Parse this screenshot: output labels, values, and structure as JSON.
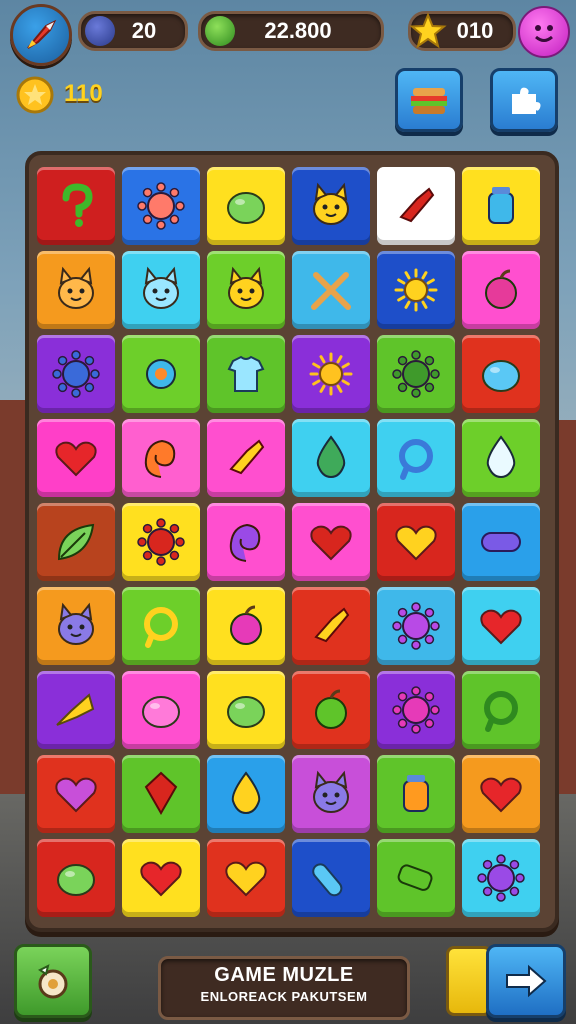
{
  "hud": {
    "hearts_value": "20",
    "coins_value": "22.800",
    "stars_value": "010",
    "gold_value": "110"
  },
  "board": {
    "rows": [
      [
        {
          "color": "#cf1f1f",
          "icon": "question-mark-icon"
        },
        {
          "color": "#2a73e6",
          "icon": "starfish-icon"
        },
        {
          "color": "#ffe01f",
          "icon": "green-leaf-blob-icon"
        },
        {
          "color": "#1e4fc9",
          "icon": "yellow-cat-icon"
        },
        {
          "color": "#ffffff",
          "icon": "red-hand-icon"
        },
        {
          "color": "#ffe01f",
          "icon": "blue-jar-icon"
        }
      ],
      [
        {
          "color": "#f59a1e",
          "icon": "orange-cat-icon"
        },
        {
          "color": "#3fd0f0",
          "icon": "blue-cat-icon"
        },
        {
          "color": "#6dcf2a",
          "icon": "yellow-cat-icon"
        },
        {
          "color": "#3fb8ea",
          "icon": "crossed-swords-icon"
        },
        {
          "color": "#1e4fc9",
          "icon": "yellow-sun-creature-icon"
        },
        {
          "color": "#ff4fcf",
          "icon": "pink-apple-icon"
        }
      ],
      [
        {
          "color": "#8a2fd9",
          "icon": "blue-spiky-ball-icon"
        },
        {
          "color": "#6dcf2a",
          "icon": "blue-gear-icon"
        },
        {
          "color": "#5fc42a",
          "icon": "shirt-icon"
        },
        {
          "color": "#8a2fd9",
          "icon": "sun-icon"
        },
        {
          "color": "#5fc42a",
          "icon": "green-bush-icon"
        },
        {
          "color": "#e0321e",
          "icon": "blue-fish-icon"
        }
      ],
      [
        {
          "color": "#ff3fc8",
          "icon": "red-heart-icon"
        },
        {
          "color": "#ff5fcf",
          "icon": "orange-swirl-icon"
        },
        {
          "color": "#ff4fcf",
          "icon": "yellow-hand-icon"
        },
        {
          "color": "#3fd0f0",
          "icon": "green-drop-icon"
        },
        {
          "color": "#3fd0f0",
          "icon": "blue-shell-icon"
        },
        {
          "color": "#6dcf2a",
          "icon": "white-drop-icon"
        }
      ],
      [
        {
          "color": "#b8431e",
          "icon": "green-leaf-icon"
        },
        {
          "color": "#ffe01f",
          "icon": "red-flower-icon"
        },
        {
          "color": "#ff4fcf",
          "icon": "purple-swirl-icon"
        },
        {
          "color": "#ff4fcf",
          "icon": "red-bird-icon"
        },
        {
          "color": "#d8261e",
          "icon": "yellow-heart-icon"
        },
        {
          "color": "#2aa0ea",
          "icon": "purple-capsule-icon"
        }
      ],
      [
        {
          "color": "#f59a1e",
          "icon": "purple-cat-icon"
        },
        {
          "color": "#6dcf2a",
          "icon": "yellow-ring-icon"
        },
        {
          "color": "#ffe01f",
          "icon": "pink-radish-icon"
        },
        {
          "color": "#e0321e",
          "icon": "yellow-shoe-icon"
        },
        {
          "color": "#3fb8ea",
          "icon": "purple-crab-icon"
        },
        {
          "color": "#3fd0f0",
          "icon": "red-heart-icon"
        }
      ],
      [
        {
          "color": "#8a2fd9",
          "icon": "trumpet-icon"
        },
        {
          "color": "#ff4fcf",
          "icon": "pink-bubble-icon"
        },
        {
          "color": "#ffe01f",
          "icon": "green-leaf-blob-icon"
        },
        {
          "color": "#e0321e",
          "icon": "green-apple-icon"
        },
        {
          "color": "#8a2fd9",
          "icon": "pink-virus-icon"
        },
        {
          "color": "#5fc42a",
          "icon": "green-knot-icon"
        }
      ],
      [
        {
          "color": "#e0321e",
          "icon": "purple-heart-icon"
        },
        {
          "color": "#5fc42a",
          "icon": "red-gem-icon"
        },
        {
          "color": "#2aa0ea",
          "icon": "yellow-blob-icon"
        },
        {
          "color": "#c84fd9",
          "icon": "purple-cat-icon"
        },
        {
          "color": "#5fc42a",
          "icon": "orange-pot-icon"
        },
        {
          "color": "#f59a1e",
          "icon": "red-heart-icon"
        }
      ],
      [
        {
          "color": "#d8261e",
          "icon": "green-blob-icon"
        },
        {
          "color": "#ffe01f",
          "icon": "red-heart-icon"
        },
        {
          "color": "#e0321e",
          "icon": "yellow-heart-icon"
        },
        {
          "color": "#1e4fc9",
          "icon": "blue-popsicle-icon"
        },
        {
          "color": "#5fc42a",
          "icon": "green-cannon-icon"
        },
        {
          "color": "#3fd0f0",
          "icon": "purple-spiky-icon"
        }
      ]
    ]
  },
  "footer": {
    "title": "GAME MUZLE",
    "subtitle": "ENLOREACK PAKUTSEM"
  }
}
